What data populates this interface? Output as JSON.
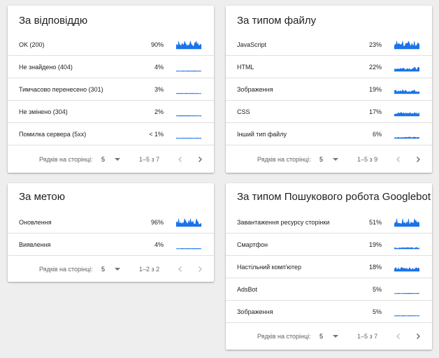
{
  "colors": {
    "spark": "#1a73e8",
    "divider": "#e0e0e0",
    "nav_disabled": "#bdbdbd",
    "nav_enabled": "#5f6368"
  },
  "cards": {
    "response": {
      "title": "За відповіддю",
      "rows": [
        {
          "label": "OK (200)",
          "percent": "90%"
        },
        {
          "label": "Не знайдено (404)",
          "percent": "4%"
        },
        {
          "label": "Тимчасово перенесено (301)",
          "percent": "3%"
        },
        {
          "label": "Не змінено (304)",
          "percent": "2%"
        },
        {
          "label": "Помилка сервера (5xx)",
          "percent": "< 1%"
        }
      ],
      "pager": {
        "rows_label": "Рядків на сторінці:",
        "rows_value": "5",
        "range": "1–5 з 7"
      }
    },
    "filetype": {
      "title": "За типом файлу",
      "rows": [
        {
          "label": "JavaScript",
          "percent": "23%"
        },
        {
          "label": "HTML",
          "percent": "22%"
        },
        {
          "label": "Зображення",
          "percent": "19%"
        },
        {
          "label": "CSS",
          "percent": "17%"
        },
        {
          "label": "Інший тип файлу",
          "percent": "6%"
        }
      ],
      "pager": {
        "rows_label": "Рядків на сторінці:",
        "rows_value": "5",
        "range": "1–5 з 9"
      }
    },
    "purpose": {
      "title": "За метою",
      "rows": [
        {
          "label": "Оновлення",
          "percent": "96%"
        },
        {
          "label": "Виявлення",
          "percent": "4%"
        }
      ],
      "pager": {
        "rows_label": "Рядків на сторінці:",
        "rows_value": "5",
        "range": "1–2 з 2"
      }
    },
    "googlebot": {
      "title": "За типом Пошукового робота Googlebot",
      "rows": [
        {
          "label": "Завантаження ресурсу сторінки",
          "percent": "51%"
        },
        {
          "label": "Смартфон",
          "percent": "19%"
        },
        {
          "label": "Настільний комп'ютер",
          "percent": "18%"
        },
        {
          "label": "AdsBot",
          "percent": "5%"
        },
        {
          "label": "Зображення",
          "percent": "5%"
        }
      ],
      "pager": {
        "rows_label": "Рядків на сторінці:",
        "rows_value": "5",
        "range": "1–5 з 7"
      }
    }
  }
}
